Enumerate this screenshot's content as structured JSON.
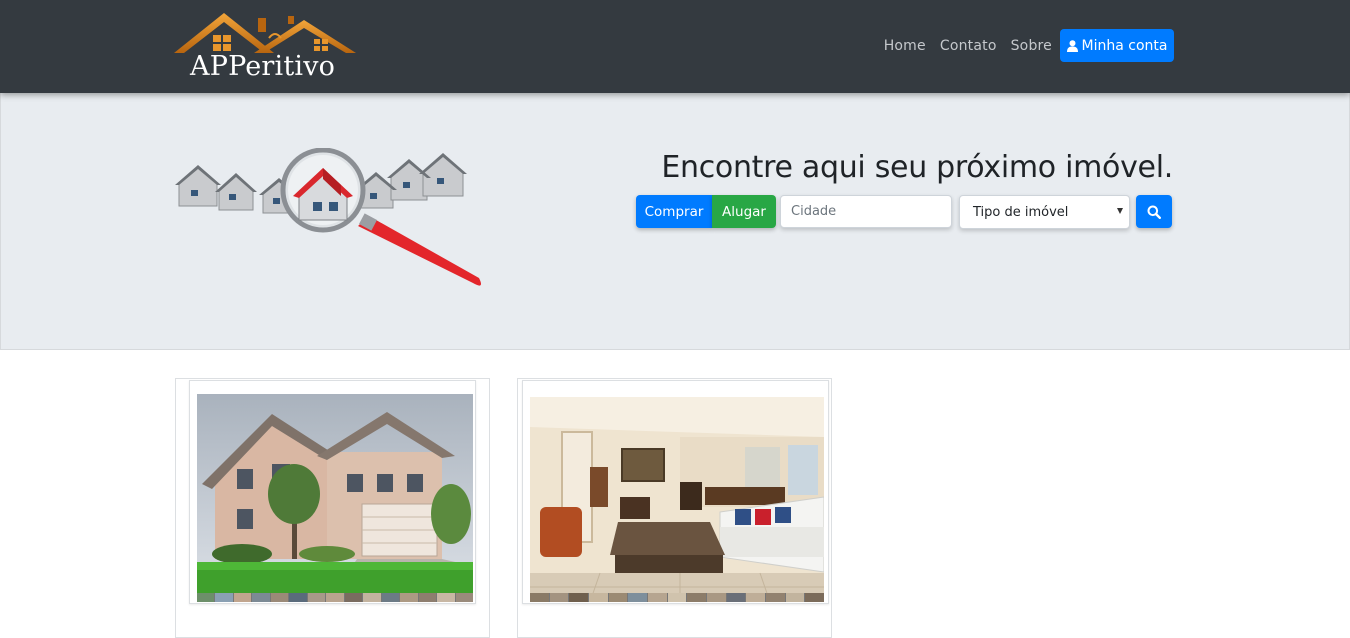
{
  "navbar": {
    "logo_text": "APPeritivo",
    "links": [
      "Home",
      "Contato",
      "Sobre"
    ],
    "account_label": "Minha conta",
    "account_icon": "user-icon",
    "bg_color": "#343a40",
    "primary_color": "#007bff"
  },
  "hero": {
    "title": "Encontre aqui seu próximo imóvel.",
    "buy_label": "Comprar",
    "rent_label": "Alugar",
    "city_placeholder": "Cidade",
    "city_value": "",
    "type_select_value": "Tipo de imóvel",
    "search_icon": "search-icon",
    "illustration": "houses-magnifying-glass",
    "buy_color": "#007bff",
    "rent_color": "#28a745",
    "bg_color": "#e8ecf0"
  },
  "listings": [
    {
      "image": "house-exterior-photo"
    },
    {
      "image": "living-room-interior-photo"
    }
  ]
}
